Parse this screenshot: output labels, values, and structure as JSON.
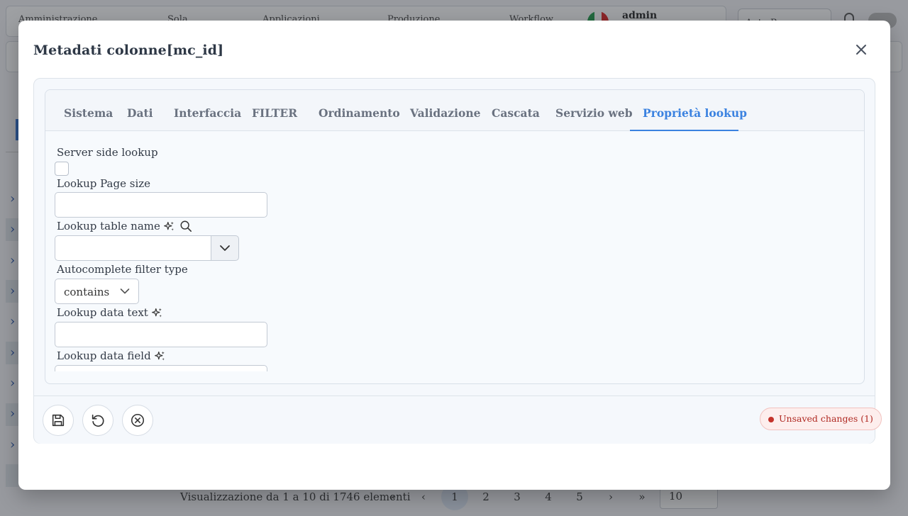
{
  "background": {
    "nav": [
      "Amministrazione",
      "Sola",
      "Applicazioni",
      "Produzione",
      "Workflow"
    ],
    "user": "admin",
    "env_select": "Auto R...",
    "pagination": {
      "summary": "Visualizzazione da 1 a 10 di 1746 elementi",
      "first": "«",
      "prev": "‹",
      "pages": [
        "1",
        "2",
        "3",
        "4",
        "5"
      ],
      "next": "›",
      "last": "»",
      "page_size": "10"
    }
  },
  "modal": {
    "title": "Metadati colonne[mc_id]",
    "tabs": [
      {
        "label": "Sistema"
      },
      {
        "label": "Dati"
      },
      {
        "label": "Interfaccia"
      },
      {
        "label": "FILTER"
      },
      {
        "label": "Ordinamento"
      },
      {
        "label": "Validazione"
      },
      {
        "label": "Cascata"
      },
      {
        "label": "Servizio web"
      },
      {
        "label": "Proprietà lookup",
        "active": true
      }
    ],
    "form": {
      "server_side_lookup": {
        "label": "Server side lookup",
        "checked": false
      },
      "lookup_page_size": {
        "label": "Lookup Page size",
        "value": ""
      },
      "lookup_table_name": {
        "label": "Lookup table name",
        "value": ""
      },
      "autocomplete_filter_type": {
        "label": "Autocomplete filter type",
        "value": "contains"
      },
      "lookup_data_text": {
        "label": "Lookup data text",
        "value": ""
      },
      "lookup_data_field": {
        "label": "Lookup data field",
        "value": ""
      }
    },
    "footer": {
      "unsaved_badge": "Unsaved changes (1)"
    },
    "colors": {
      "accent": "#3b82e0",
      "badge_text": "#b02a23",
      "badge_bg": "#fdeeed"
    }
  }
}
